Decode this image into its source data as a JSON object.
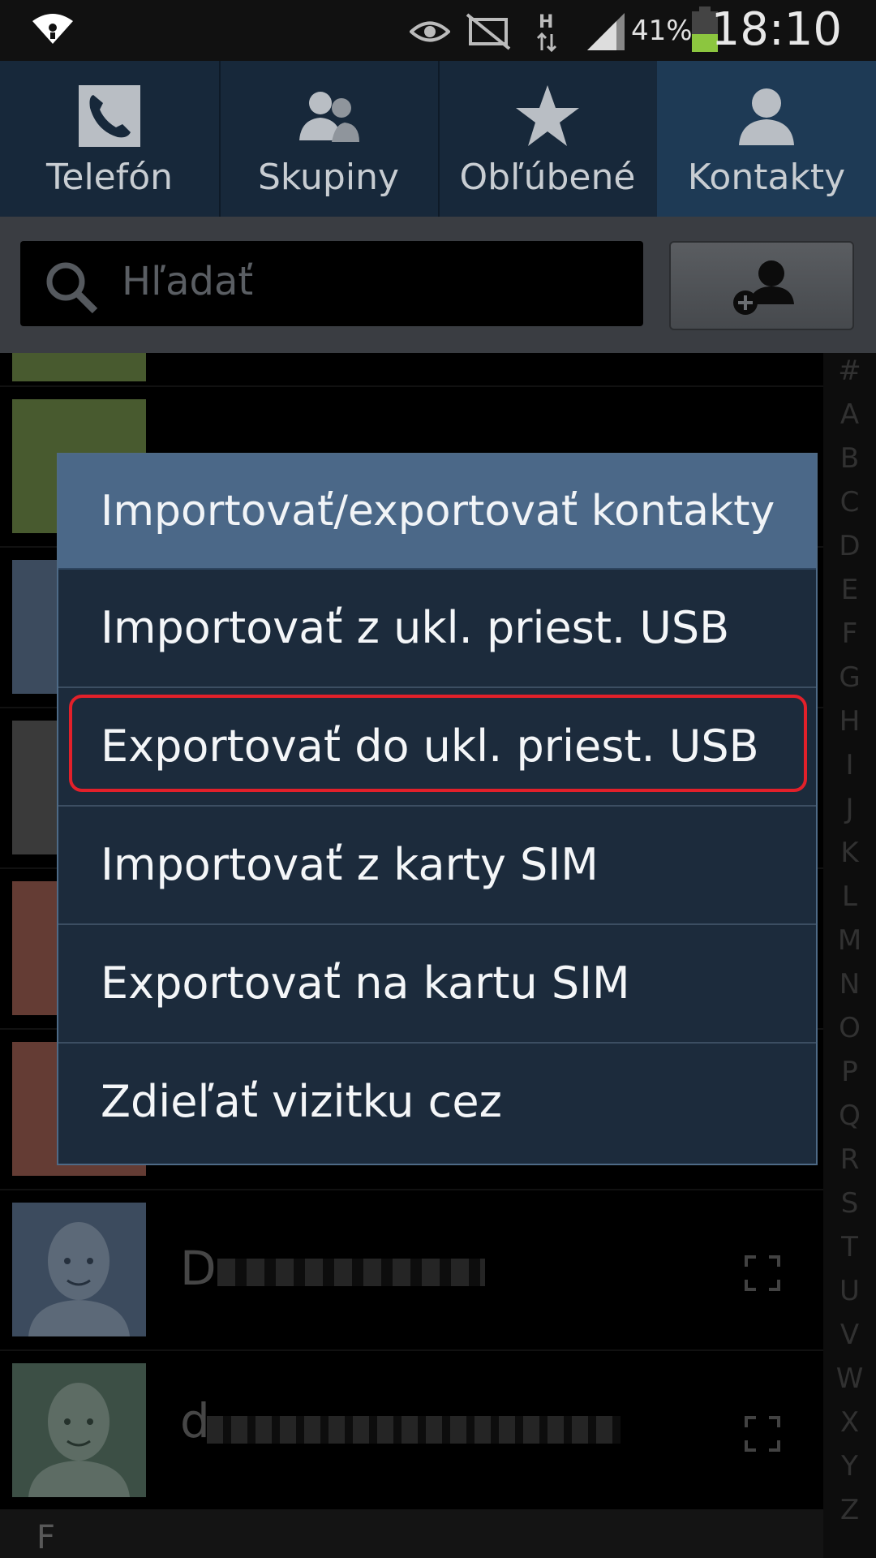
{
  "status_bar": {
    "battery_percent": "41%",
    "time": "18:10",
    "icons": [
      "wifi-icon",
      "eye-icon",
      "mute-icon",
      "h-network-icon",
      "signal-icon",
      "battery-icon"
    ]
  },
  "tabs": [
    {
      "label": "Telefón",
      "icon": "phone-icon"
    },
    {
      "label": "Skupiny",
      "icon": "group-icon"
    },
    {
      "label": "Obľúbené",
      "icon": "star-icon"
    },
    {
      "label": "Kontakty",
      "icon": "person-icon",
      "active": true
    }
  ],
  "search": {
    "placeholder": "Hľadať"
  },
  "add_contact_icon": "add-contact-icon",
  "contacts": [
    {
      "name": "D"
    },
    {
      "name": "d"
    }
  ],
  "section_letter": "F",
  "index_letters": [
    "#",
    "A",
    "B",
    "C",
    "D",
    "E",
    "F",
    "G",
    "H",
    "I",
    "J",
    "K",
    "L",
    "M",
    "N",
    "O",
    "P",
    "Q",
    "R",
    "S",
    "T",
    "U",
    "V",
    "W",
    "X",
    "Y",
    "Z"
  ],
  "dialog": {
    "title": "Importovať/exportovať kontakty",
    "options": [
      "Importovať z ukl. priest. USB",
      "Exportovať do ukl. priest. USB",
      "Importovať z karty SIM",
      "Exportovať na kartu SIM",
      "Zdieľať vizitku cez"
    ],
    "highlighted_index": 1
  },
  "colors": {
    "dialog_title_bg": "#4b6888",
    "dialog_bg": "#1c2b3c",
    "highlight": "#e2202a",
    "active_tab": "#1e3a55"
  }
}
